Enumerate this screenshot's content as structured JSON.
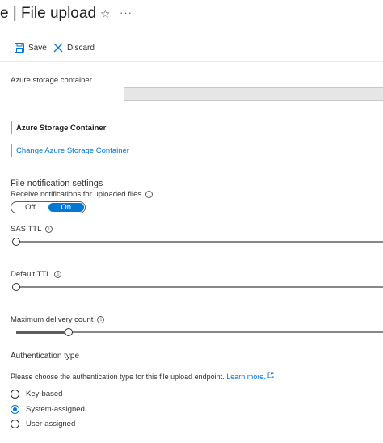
{
  "header": {
    "title": "e | File upload",
    "star_glyph": "☆",
    "more_glyph": "···"
  },
  "toolbar": {
    "save_label": "Save",
    "discard_label": "Discard"
  },
  "storage": {
    "container_label": "Azure storage container",
    "container_value": "",
    "block_title": "Azure Storage Container",
    "change_link": "Change Azure Storage Container"
  },
  "notifications": {
    "section_title": "File notification settings",
    "receive_label": "Receive notifications for uploaded files",
    "toggle_off": "Off",
    "toggle_on": "On",
    "toggle_value": "On"
  },
  "sliders": {
    "sas_ttl_label": "SAS TTL",
    "sas_ttl_fraction": 0.0,
    "default_ttl_label": "Default TTL",
    "default_ttl_fraction": 0.0,
    "max_delivery_label": "Maximum delivery count",
    "max_delivery_fraction": 0.14
  },
  "auth": {
    "section_title": "Authentication type",
    "description": "Please choose the authentication type for this file upload endpoint.",
    "learn_more": "Learn more.",
    "options": [
      "Key-based",
      "System-assigned",
      "User-assigned"
    ],
    "selected": "System-assigned"
  },
  "colors": {
    "accent": "#0078d4",
    "block_bar": "#8cbd18"
  }
}
